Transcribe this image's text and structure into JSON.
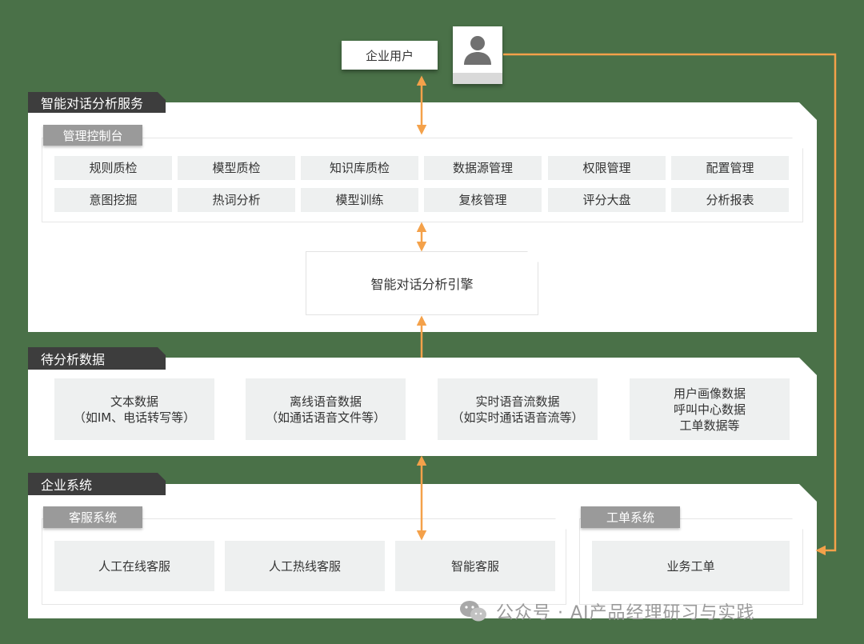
{
  "user": {
    "label": "企业用户",
    "icon": "user-avatar-icon"
  },
  "service": {
    "title": "智能对话分析服务",
    "console": {
      "title": "管理控制台",
      "rows": [
        [
          "规则质检",
          "模型质检",
          "知识库质检",
          "数据源管理",
          "权限管理",
          "配置管理"
        ],
        [
          "意图挖掘",
          "热词分析",
          "模型训练",
          "复核管理",
          "评分大盘",
          "分析报表"
        ]
      ]
    },
    "engine": "智能对话分析引擎"
  },
  "pending": {
    "title": "待分析数据",
    "items": [
      [
        "文本数据",
        "（如IM、电话转写等）"
      ],
      [
        "离线语音数据",
        "（如通话语音文件等）"
      ],
      [
        "实时语音流数据",
        "（如实时通话语音流等）"
      ],
      [
        "用户画像数据",
        "呼叫中心数据",
        "工单数据等"
      ]
    ]
  },
  "enterprise": {
    "title": "企业系统",
    "cs": {
      "title": "客服系统",
      "items": [
        "人工在线客服",
        "人工热线客服",
        "智能客服"
      ]
    },
    "ticket": {
      "title": "工单系统",
      "items": [
        "业务工单"
      ]
    }
  },
  "watermark": {
    "icon": "wechat-icon",
    "text": "公众号 · AI产品经理研习与实践"
  },
  "colors": {
    "background": "#4a7148",
    "arrow": "#f4a14a",
    "tab_dark": "#3d3d3d",
    "tab_grey": "#9a9a9a",
    "cell": "#eef0f0"
  }
}
